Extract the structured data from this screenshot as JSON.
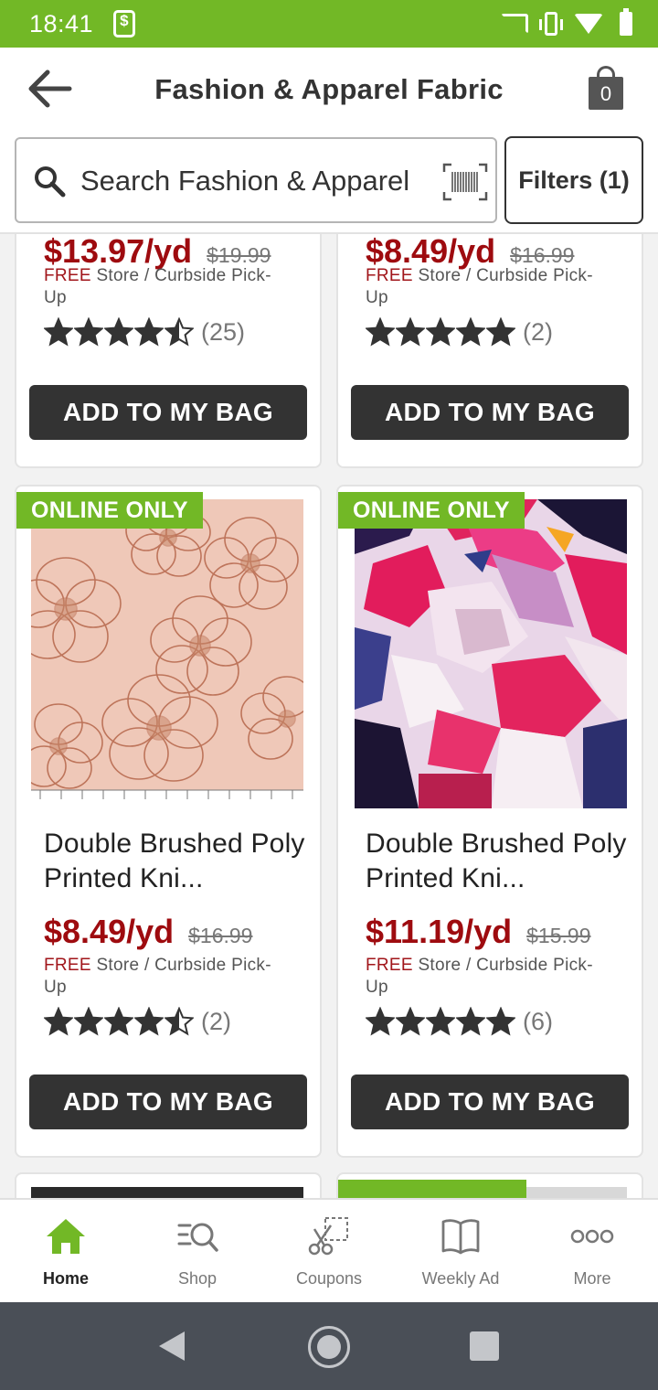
{
  "status_bar": {
    "time": "18:41"
  },
  "header": {
    "title": "Fashion & Apparel Fabric",
    "bag_count": "0"
  },
  "search": {
    "placeholder": "Search Fashion & Apparel",
    "filters_label": "Filters (1)"
  },
  "products": [
    {
      "badge": "",
      "name": "",
      "price": "$13.97/yd",
      "was_price": "$19.99",
      "pickup_free": "FREE",
      "pickup_text": " Store / Curbside Pick-Up",
      "rating": 4.5,
      "reviews": "(25)",
      "button": "ADD TO MY BAG"
    },
    {
      "badge": "",
      "name": "",
      "price": "$8.49/yd",
      "was_price": "$16.99",
      "pickup_free": "FREE",
      "pickup_text": " Store / Curbside Pick-Up",
      "rating": 5,
      "reviews": "(2)",
      "button": "ADD TO MY BAG"
    },
    {
      "badge": "ONLINE ONLY",
      "name": "Double Brushed Poly Printed Kni...",
      "price": "$8.49/yd",
      "was_price": "$16.99",
      "pickup_free": "FREE",
      "pickup_text": " Store / Curbside Pick-Up",
      "rating": 4.5,
      "reviews": "(2)",
      "button": "ADD TO MY BAG"
    },
    {
      "badge": "ONLINE ONLY",
      "name": "Double Brushed Poly Printed Kni...",
      "price": "$11.19/yd",
      "was_price": "$15.99",
      "pickup_free": "FREE",
      "pickup_text": " Store / Curbside Pick-Up",
      "rating": 5,
      "reviews": "(6)",
      "button": "ADD TO MY BAG"
    }
  ],
  "bottom_nav": [
    {
      "label": "Home",
      "icon": "home-icon",
      "active": true
    },
    {
      "label": "Shop",
      "icon": "shop-search-icon",
      "active": false
    },
    {
      "label": "Coupons",
      "icon": "scissors-coupon-icon",
      "active": false
    },
    {
      "label": "Weekly Ad",
      "icon": "open-book-icon",
      "active": false
    },
    {
      "label": "More",
      "icon": "more-dots-icon",
      "active": false
    }
  ],
  "colors": {
    "brand_green": "#72b826",
    "price_red": "#9e0b0f",
    "button_dark": "#333333",
    "android_nav": "#4a4f57"
  }
}
